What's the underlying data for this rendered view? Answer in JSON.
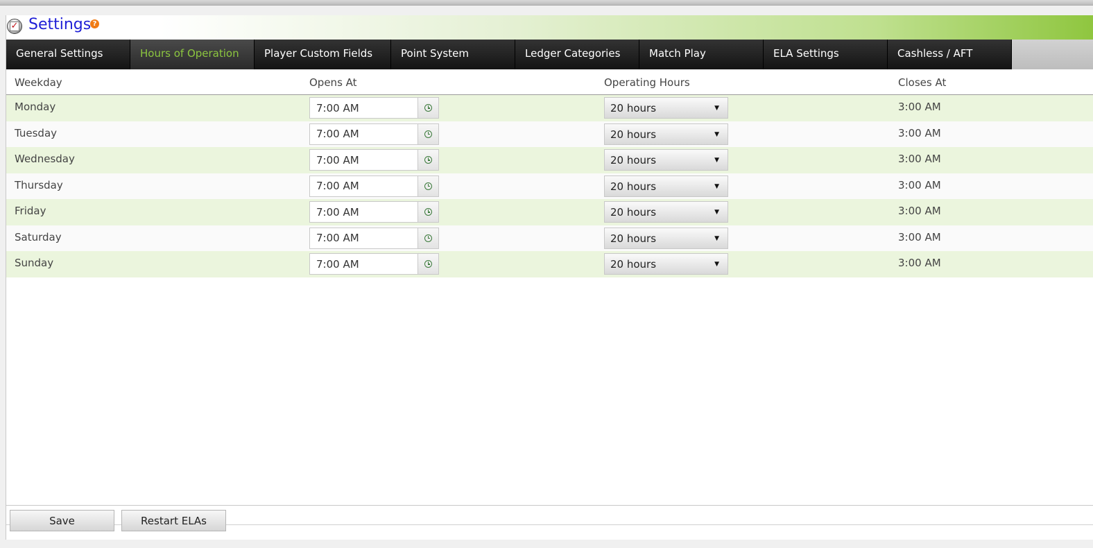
{
  "app": {
    "title": "Settings",
    "help": "?"
  },
  "tabs": [
    {
      "label": "General Settings",
      "active": false
    },
    {
      "label": "Hours of Operation",
      "active": true
    },
    {
      "label": "Player Custom Fields",
      "active": false
    },
    {
      "label": "Point System",
      "active": false
    },
    {
      "label": "Ledger Categories",
      "active": false
    },
    {
      "label": "Match Play",
      "active": false
    },
    {
      "label": "ELA Settings",
      "active": false
    },
    {
      "label": "Cashless / AFT",
      "active": false
    }
  ],
  "table": {
    "headers": {
      "weekday": "Weekday",
      "opens_at": "Opens At",
      "operating_hours": "Operating Hours",
      "closes_at": "Closes At"
    },
    "rows": [
      {
        "day": "Monday",
        "opens": "7:00 AM",
        "hours": "20 hours",
        "closes": "3:00 AM"
      },
      {
        "day": "Tuesday",
        "opens": "7:00 AM",
        "hours": "20 hours",
        "closes": "3:00 AM"
      },
      {
        "day": "Wednesday",
        "opens": "7:00 AM",
        "hours": "20 hours",
        "closes": "3:00 AM"
      },
      {
        "day": "Thursday",
        "opens": "7:00 AM",
        "hours": "20 hours",
        "closes": "3:00 AM"
      },
      {
        "day": "Friday",
        "opens": "7:00 AM",
        "hours": "20 hours",
        "closes": "3:00 AM"
      },
      {
        "day": "Saturday",
        "opens": "7:00 AM",
        "hours": "20 hours",
        "closes": "3:00 AM"
      },
      {
        "day": "Sunday",
        "opens": "7:00 AM",
        "hours": "20 hours",
        "closes": "3:00 AM"
      }
    ]
  },
  "footer": {
    "save_label": "Save",
    "restart_label": "Restart ELAs"
  },
  "colors": {
    "title_blue": "#1f1fd6",
    "active_tab_green": "#8cc63f",
    "row_stripe": "#ebf5dd",
    "help_orange": "#f07b14"
  },
  "icons": {
    "app": "settings-check-icon",
    "help": "help-icon",
    "time_picker": "clock-icon",
    "dropdown": "triangle-down-icon"
  }
}
